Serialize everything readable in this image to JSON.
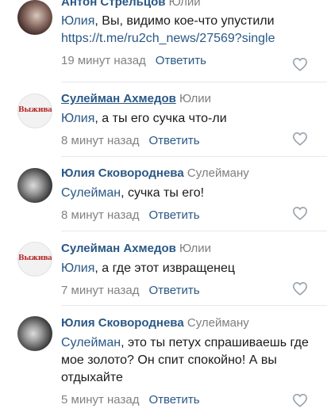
{
  "comments": [
    {
      "author": "Антон Стрельцов",
      "reply_to": "Юлии",
      "mention": "Юлия",
      "text": ", Вы, видимо кое-что упустили",
      "link": "https://t.me/ru2ch_news/27569?single",
      "time": "19 минут назад",
      "reply_label": "Ответить",
      "avatar_icon": "user-photo"
    },
    {
      "author": "Сулейман Ахмедов",
      "reply_to": "Юлии",
      "mention": "Юлия",
      "text": ", а ты его сучка что-ли",
      "time": "8 минут назад",
      "reply_label": "Ответить",
      "avatar_text": "Выживани"
    },
    {
      "author": "Юлия Сковороднева",
      "reply_to": "Сулейману",
      "mention": "Сулейман",
      "text": ", сучка ты его!",
      "time": "8 минут назад",
      "reply_label": "Ответить",
      "avatar_icon": "user-photo"
    },
    {
      "author": "Сулейман Ахмедов",
      "reply_to": "Юлии",
      "mention": "Юлия",
      "text": ", а где этот извращенец",
      "time": "7 минут назад",
      "reply_label": "Ответить",
      "avatar_text": "Выживани"
    },
    {
      "author": "Юлия Сковороднева",
      "reply_to": "Сулейману",
      "mention": "Сулейман",
      "text": ", это ты петух спрашиваешь где мое золото? Он спит спокойно! А вы отдыхайте",
      "time": "5 минут назад",
      "reply_label": "Ответить",
      "avatar_icon": "user-photo"
    }
  ],
  "colors": {
    "link": "#2a5885",
    "meta": "#828282",
    "divider": "#e7e8ec"
  },
  "icons": {
    "like": "heart-icon"
  }
}
